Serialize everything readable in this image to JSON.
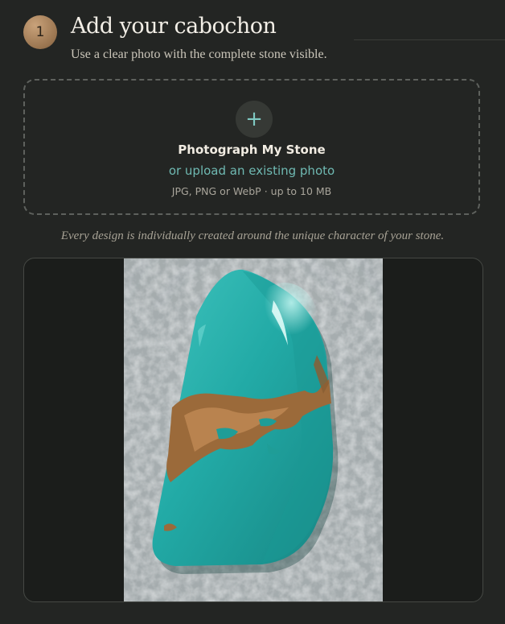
{
  "step": {
    "number": "1",
    "title": "Add your cabochon",
    "subtitle": "Use a clear photo with the complete stone visible."
  },
  "dropzone": {
    "icon": "plus-icon",
    "primary_label": "Photograph My Stone",
    "secondary_label": "or upload an existing photo",
    "hint": "JPG, PNG or WebP · up to 10 MB"
  },
  "note": "Every design is individually created around the unique character of your stone.",
  "preview": {
    "subject": "turquoise cabochon photo"
  },
  "colors": {
    "background": "#232523",
    "accent": "#6fb9b2",
    "badge": "#b08a62"
  }
}
